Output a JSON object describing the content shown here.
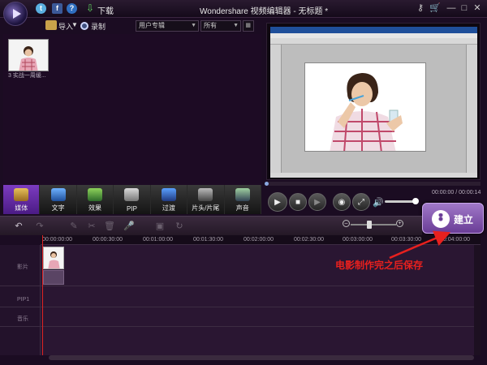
{
  "titlebar": {
    "download_label": "下载",
    "window_title": "Wondershare 视频编辑器 - 无标题 *"
  },
  "media": {
    "import_label": "导入",
    "record_label": "录制",
    "album_select": "用户专辑",
    "filter_select": "所有",
    "thumb_caption": "3 实战一周缓..."
  },
  "categories": [
    {
      "label": "媒体",
      "icon": "media-icon",
      "active": true
    },
    {
      "label": "文字",
      "icon": "text-icon"
    },
    {
      "label": "效果",
      "icon": "effects-icon"
    },
    {
      "label": "PIP",
      "icon": "pip-icon"
    },
    {
      "label": "过渡",
      "icon": "transition-icon"
    },
    {
      "label": "片头/片尾",
      "icon": "intro-outro-icon"
    },
    {
      "label": "声音",
      "icon": "sound-icon"
    }
  ],
  "preview": {
    "timecode": "00:00:00 / 00:00:14"
  },
  "create_button": {
    "label": "建立"
  },
  "timeline": {
    "ruler": [
      "00:00:00:00",
      "00:00:30:00",
      "00:01:00:00",
      "00:01:30:00",
      "00:02:00:00",
      "00:02:30:00",
      "00:03:00:00",
      "00:03:30:00",
      "00:04:00:00"
    ],
    "tracks": {
      "video": "影片",
      "pip": "PIP1",
      "music": "音乐"
    }
  },
  "annotation": {
    "text": "电影制作完之后保存",
    "color": "#e8201e"
  },
  "colors": {
    "accent": "#7c3cc0",
    "background": "#1b0c22"
  }
}
